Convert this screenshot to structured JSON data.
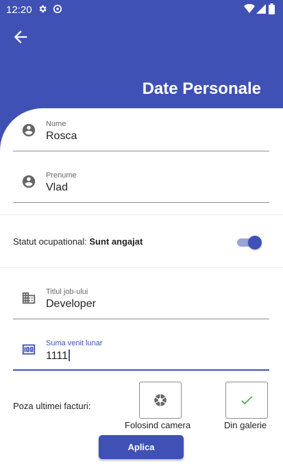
{
  "status_bar": {
    "time": "12:20",
    "icons": [
      "gear-icon",
      "at-icon",
      "wifi-icon",
      "signal-icon",
      "battery-icon"
    ]
  },
  "header": {
    "title": "Date Personale",
    "back_icon": "arrow-left-icon",
    "color": "#3f51b5"
  },
  "form": {
    "last_name": {
      "label": "Nume",
      "value": "Rosca",
      "icon": "account-circle-icon"
    },
    "first_name": {
      "label": "Prenume",
      "value": "Vlad",
      "icon": "account-circle-icon"
    },
    "occupation": {
      "label": "Statut ocupational:",
      "value": "Sunt angajat",
      "switch_on": true
    },
    "job_title": {
      "label": "Titlul job-ului",
      "value": "Developer",
      "icon": "building-icon"
    },
    "income": {
      "label": "Suma venit lunar",
      "value": "1111",
      "icon": "money-icon",
      "focused": true
    }
  },
  "invoice": {
    "label": "Poza ultimei facturi:",
    "camera_label": "Folosind camera",
    "gallery_label": "Din galerie",
    "camera_icon": "aperture-icon",
    "gallery_icon": "check-icon",
    "check_color": "#4caf50"
  },
  "apply_label": "Aplica"
}
